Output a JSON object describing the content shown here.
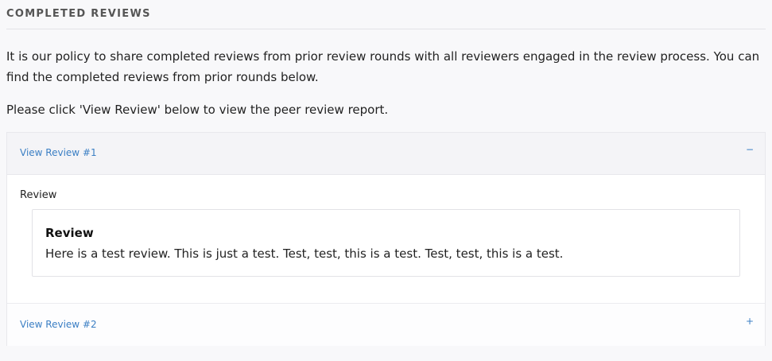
{
  "section": {
    "title": "COMPLETED REVIEWS"
  },
  "intro": {
    "policy_text": "It is our policy to share completed reviews from prior review rounds with all reviewers engaged in the review process. You can find the completed reviews from prior rounds below.",
    "instruction_text": "Please click 'View Review' below to view the peer review report."
  },
  "reviews": [
    {
      "link_label": "View Review #1",
      "toggle_symbol": "−",
      "expanded": true,
      "field_label": "Review",
      "content_title": "Review",
      "content_text": "Here is a test review. This is just a test. Test, test, this is a test. Test, test, this is a test."
    },
    {
      "link_label": "View Review #2",
      "toggle_symbol": "+",
      "expanded": false
    }
  ],
  "colors": {
    "link": "#3b7fc4",
    "header_bg": "#f4f4f7",
    "page_bg": "#f8f8fa"
  }
}
